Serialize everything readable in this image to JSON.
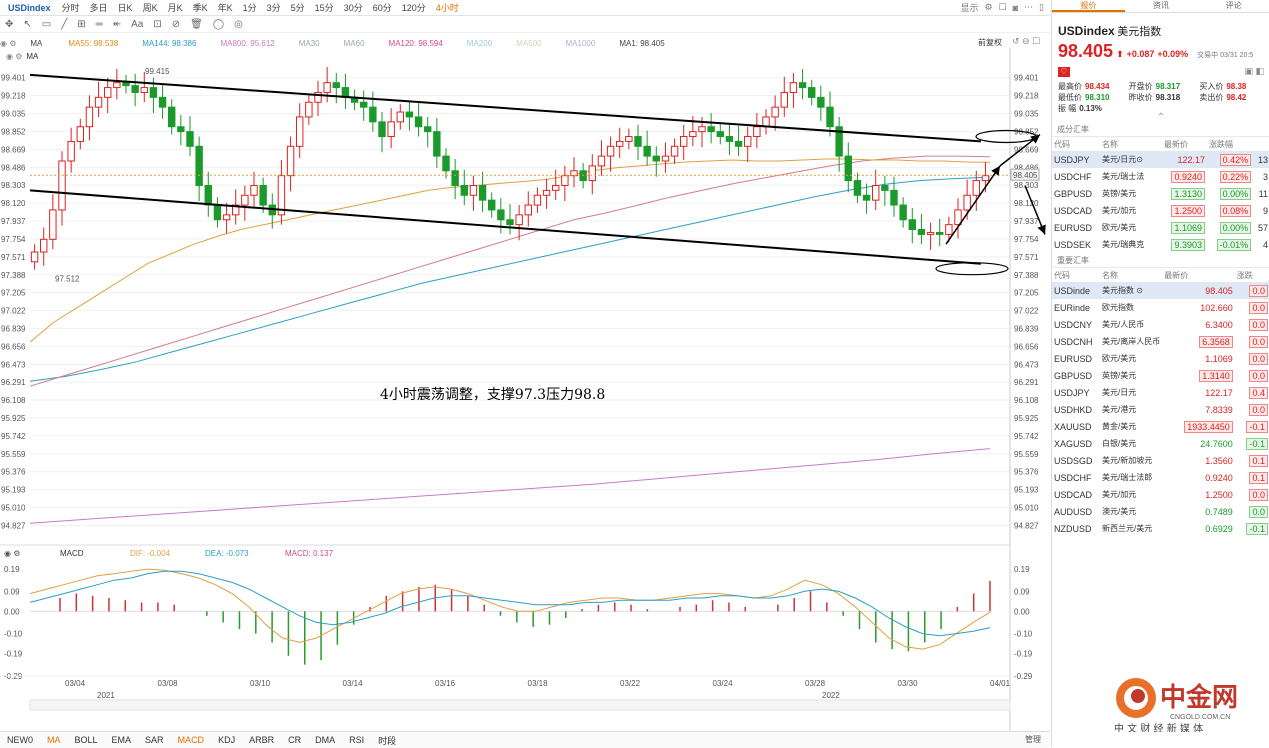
{
  "toolbar": {
    "symbol": "USDindex",
    "timeframes": [
      "分时",
      "多日",
      "日K",
      "周K",
      "月K",
      "季K",
      "年K",
      "1分",
      "3分",
      "5分",
      "15分",
      "30分",
      "60分",
      "120分",
      "4小时"
    ],
    "active_timeframe": "4小时",
    "right": {
      "display": "显示"
    }
  },
  "ma_legend_main": [
    {
      "label": "MA",
      "color": "#444"
    },
    {
      "label": "MA55: 98.538",
      "color": "#e08a1a"
    },
    {
      "label": "MA144: 98.386",
      "color": "#2aa0c8"
    },
    {
      "label": "MA800: 95.612",
      "color": "#c87ac8"
    },
    {
      "label": "MA30",
      "color": "#9aa"
    },
    {
      "label": "MA60",
      "color": "#9aa"
    },
    {
      "label": "MA120: 98.594",
      "color": "#d24a8a"
    },
    {
      "label": "MA200",
      "color": "#9cc"
    },
    {
      "label": "MA500",
      "color": "#dcb"
    },
    {
      "label": "MA1000",
      "color": "#bac"
    },
    {
      "label": "MA1: 98.405",
      "color": "#444"
    }
  ],
  "ma_legend_right": "前复权",
  "ma_legend_sub": "MA",
  "macd_legend": {
    "name": "MACD",
    "dif": "DIF: -0.004",
    "dea": "DEA: -0.073",
    "macd": "MACD: 0.137"
  },
  "annotation": "4小时震荡调整，支撑97.3压力98.8",
  "high_label": "99.415",
  "low_label": "97.512",
  "current_price_tag": "98.405",
  "indicator_tabs": [
    "NEW0",
    "MA",
    "BOLL",
    "EMA",
    "SAR",
    "MACD",
    "KDJ",
    "ARBR",
    "CR",
    "DMA",
    "RSI",
    "时段"
  ],
  "indicator_active": [
    "MA",
    "MACD"
  ],
  "manage_label": "管理",
  "years": {
    "left": "2021",
    "right": "2022"
  },
  "chart_data": {
    "type": "candlestick",
    "y_ticks": [
      "99.401",
      "99.218",
      "99.035",
      "98.852",
      "98.669",
      "98.486",
      "98.303",
      "98.120",
      "97.937",
      "97.754",
      "97.571",
      "97.388",
      "97.205",
      "97.022",
      "96.839",
      "96.656",
      "96.473",
      "96.291",
      "96.108",
      "95.925",
      "95.742",
      "95.559",
      "95.376",
      "95.193",
      "95.010",
      "94.827"
    ],
    "ylim": [
      94.75,
      99.5
    ],
    "x_ticks": [
      "03/04",
      "03/08",
      "03/10",
      "03/14",
      "03/16",
      "03/18",
      "03/22",
      "03/24",
      "03/28",
      "03/30",
      "04/01"
    ],
    "closes": [
      97.62,
      97.75,
      98.05,
      98.55,
      98.75,
      98.9,
      99.1,
      99.2,
      99.3,
      99.35,
      99.32,
      99.25,
      99.3,
      99.2,
      99.1,
      98.9,
      98.85,
      98.7,
      98.3,
      98.1,
      97.95,
      98.0,
      98.1,
      98.2,
      98.3,
      98.1,
      98.0,
      98.4,
      98.7,
      99.0,
      99.15,
      99.25,
      99.35,
      99.3,
      99.2,
      99.15,
      99.1,
      98.95,
      98.8,
      98.95,
      99.05,
      99.0,
      98.9,
      98.85,
      98.6,
      98.45,
      98.3,
      98.2,
      98.3,
      98.15,
      98.05,
      97.95,
      97.9,
      98.0,
      98.1,
      98.2,
      98.25,
      98.3,
      98.4,
      98.45,
      98.35,
      98.5,
      98.6,
      98.7,
      98.75,
      98.8,
      98.7,
      98.6,
      98.55,
      98.6,
      98.7,
      98.8,
      98.85,
      98.9,
      98.85,
      98.8,
      98.75,
      98.7,
      98.8,
      98.9,
      99.0,
      99.1,
      99.25,
      99.35,
      99.3,
      99.2,
      99.1,
      98.9,
      98.6,
      98.35,
      98.2,
      98.15,
      98.3,
      98.25,
      98.1,
      97.95,
      97.85,
      97.8,
      97.82,
      97.8,
      97.9,
      98.05,
      98.2,
      98.35,
      98.4
    ],
    "ma55": [
      96.7,
      96.9,
      97.05,
      97.2,
      97.35,
      97.5,
      97.6,
      97.7,
      97.78,
      97.85,
      97.9,
      97.95,
      98.0,
      98.05,
      98.1,
      98.15,
      98.2,
      98.25,
      98.28,
      98.3,
      98.32,
      98.34,
      98.36,
      98.4,
      98.45,
      98.48,
      98.5,
      98.52,
      98.54,
      98.55,
      98.56,
      98.55,
      98.55,
      98.56,
      98.57,
      98.57,
      98.56,
      98.56,
      98.55,
      98.55,
      98.54,
      98.538
    ],
    "ma120": [
      96.25,
      96.35,
      96.45,
      96.55,
      96.65,
      96.75,
      96.85,
      96.95,
      97.05,
      97.15,
      97.25,
      97.35,
      97.45,
      97.55,
      97.65,
      97.75,
      97.85,
      97.95,
      98.02,
      98.1,
      98.18,
      98.25,
      98.32,
      98.38,
      98.44,
      98.5,
      98.55,
      98.58,
      98.6,
      98.6,
      98.594
    ],
    "ma144": [
      96.3,
      96.35,
      96.42,
      96.5,
      96.6,
      96.7,
      96.8,
      96.9,
      97.0,
      97.1,
      97.2,
      97.3,
      97.38,
      97.46,
      97.54,
      97.62,
      97.7,
      97.78,
      97.86,
      97.94,
      98.02,
      98.1,
      98.18,
      98.25,
      98.31,
      98.35,
      98.37,
      98.386
    ],
    "ma800": [
      94.85,
      94.89,
      94.93,
      94.97,
      95.01,
      95.05,
      95.09,
      95.13,
      95.17,
      95.21,
      95.25,
      95.3,
      95.35,
      95.4,
      95.45,
      95.5,
      95.56,
      95.612
    ],
    "trendlines": [
      {
        "from": [
          0,
          99.43
        ],
        "to": [
          104,
          98.75
        ]
      },
      {
        "from": [
          0,
          98.25
        ],
        "to": [
          104,
          97.5
        ]
      }
    ],
    "macd": {
      "ylim": [
        -0.3,
        0.24
      ],
      "y_ticks": [
        "0.19",
        "0.09",
        "0.00",
        "-0.10",
        "-0.19",
        "-0.29"
      ],
      "dif": [
        0.08,
        0.1,
        0.12,
        0.14,
        0.16,
        0.17,
        0.18,
        0.19,
        0.185,
        0.17,
        0.15,
        0.12,
        0.08,
        0.02,
        -0.06,
        -0.12,
        -0.14,
        -0.12,
        -0.08,
        -0.04,
        0.0,
        0.04,
        0.08,
        0.1,
        0.11,
        0.1,
        0.08,
        0.05,
        0.02,
        0.0,
        0.0,
        0.02,
        0.04,
        0.05,
        0.06,
        0.06,
        0.05,
        0.05,
        0.06,
        0.07,
        0.08,
        0.08,
        0.07,
        0.06,
        0.07,
        0.1,
        0.14,
        0.12,
        0.08,
        0.02,
        -0.05,
        -0.12,
        -0.16,
        -0.17,
        -0.15,
        -0.1,
        -0.05,
        -0.004
      ],
      "dea": [
        0.04,
        0.06,
        0.08,
        0.1,
        0.12,
        0.14,
        0.15,
        0.17,
        0.18,
        0.18,
        0.17,
        0.15,
        0.13,
        0.1,
        0.06,
        0.02,
        -0.02,
        -0.05,
        -0.06,
        -0.05,
        -0.03,
        -0.01,
        0.02,
        0.04,
        0.06,
        0.07,
        0.07,
        0.06,
        0.05,
        0.04,
        0.03,
        0.03,
        0.03,
        0.04,
        0.04,
        0.05,
        0.05,
        0.05,
        0.05,
        0.06,
        0.06,
        0.07,
        0.07,
        0.06,
        0.06,
        0.07,
        0.09,
        0.1,
        0.09,
        0.06,
        0.02,
        -0.03,
        -0.07,
        -0.1,
        -0.11,
        -0.1,
        -0.09,
        -0.073
      ],
      "hist": [
        0.06,
        0.08,
        0.07,
        0.06,
        0.05,
        0.04,
        0.04,
        0.03,
        0.0,
        -0.02,
        -0.05,
        -0.08,
        -0.1,
        -0.14,
        -0.2,
        -0.24,
        -0.22,
        -0.15,
        -0.06,
        0.02,
        0.07,
        0.09,
        0.11,
        0.12,
        0.1,
        0.07,
        0.03,
        -0.02,
        -0.05,
        -0.07,
        -0.06,
        -0.03,
        0.01,
        0.03,
        0.04,
        0.03,
        0.01,
        0.0,
        0.02,
        0.03,
        0.05,
        0.04,
        0.02,
        0.0,
        0.03,
        0.06,
        0.09,
        0.04,
        -0.02,
        -0.08,
        -0.14,
        -0.17,
        -0.18,
        -0.14,
        -0.08,
        0.02,
        0.08,
        0.137
      ]
    }
  },
  "quote": {
    "symbol": "USDindex",
    "name": "美元指数",
    "price": "98.405",
    "arrow": "⬆",
    "change": "+0.087",
    "change_pct": "+0.09%",
    "status": "交易中 03/31 20:5",
    "rows": [
      [
        {
          "k": "最高价",
          "v": "98.434",
          "c": "red"
        },
        {
          "k": "开盘价",
          "v": "98.317",
          "c": "green"
        },
        {
          "k": "买入价",
          "v": "98.38",
          "c": "red"
        }
      ],
      [
        {
          "k": "最低价",
          "v": "98.310",
          "c": "green"
        },
        {
          "k": "昨收价",
          "v": "98.318",
          "c": ""
        },
        {
          "k": "卖出价",
          "v": "98.42",
          "c": "red"
        }
      ],
      [
        {
          "k": "振 幅",
          "v": "0.13%",
          "c": ""
        }
      ]
    ]
  },
  "tabs": [
    "报价",
    "资讯",
    "评论"
  ],
  "section1": {
    "title": "成分汇率",
    "headers": [
      "代码",
      "名称",
      "最新价",
      "涨跌幅"
    ],
    "rows": [
      {
        "code": "USDJPY",
        "name": "美元/日元⊙",
        "price": "122.17",
        "pct": "0.42%",
        "extra": "13",
        "dir": "red",
        "sel": true
      },
      {
        "code": "USDCHF",
        "name": "美元/瑞士法",
        "price": "0.9240",
        "pct": "0.22%",
        "extra": "3",
        "dir": "red",
        "sel": false
      },
      {
        "code": "GBPUSD",
        "name": "英镑/美元",
        "price": "1.3130",
        "pct": "0.00%",
        "extra": "11",
        "dir": "green",
        "sel": false
      },
      {
        "code": "USDCAD",
        "name": "美元/加元",
        "price": "1.2500",
        "pct": "0.08%",
        "extra": "9",
        "dir": "red",
        "sel": false
      },
      {
        "code": "EURUSD",
        "name": "欧元/美元",
        "price": "1.1069",
        "pct": "0.00%",
        "extra": "57",
        "dir": "green",
        "sel": false
      },
      {
        "code": "USDSEK",
        "name": "美元/瑞典克",
        "price": "9.3903",
        "pct": "-0.01%",
        "extra": "4",
        "dir": "green",
        "sel": false
      }
    ]
  },
  "section2": {
    "title": "重要汇率",
    "headers": [
      "代码",
      "名称",
      "最新价",
      "涨跌"
    ],
    "rows": [
      {
        "code": "USDinde",
        "name": "美元指数 ⊙",
        "price": "98.405",
        "pct": "0.0",
        "dir": "red",
        "sel": true
      },
      {
        "code": "EURinde",
        "name": "欧元指数",
        "price": "102.660",
        "pct": "0.0",
        "dir": "red",
        "sel": false
      },
      {
        "code": "USDCNY",
        "name": "美元/人民币",
        "price": "6.3400",
        "pct": "0.0",
        "dir": "red",
        "sel": false
      },
      {
        "code": "USDCNH",
        "name": "美元/离岸人民币",
        "price": "6.3568",
        "pct": "0.0",
        "dir": "red",
        "sel": false
      },
      {
        "code": "EURUSD",
        "name": "欧元/美元",
        "price": "1.1069",
        "pct": "0.0",
        "dir": "red",
        "sel": false
      },
      {
        "code": "GBPUSD",
        "name": "英镑/美元",
        "price": "1.3140",
        "pct": "0.0",
        "dir": "red",
        "sel": false
      },
      {
        "code": "USDJPY",
        "name": "美元/日元",
        "price": "122.17",
        "pct": "0.4",
        "dir": "red",
        "sel": false
      },
      {
        "code": "USDHKD",
        "name": "美元/港元",
        "price": "7.8339",
        "pct": "0.0",
        "dir": "red",
        "sel": false
      },
      {
        "code": "XAUUSD",
        "name": "黄金/美元",
        "price": "1933.4450",
        "pct": "-0.1",
        "dir": "red",
        "sel": false
      },
      {
        "code": "XAGUSD",
        "name": "白银/美元",
        "price": "24.7600",
        "pct": "-0.1",
        "dir": "green",
        "sel": false
      },
      {
        "code": "USDSGD",
        "name": "美元/新加坡元",
        "price": "1.3560",
        "pct": "0.1",
        "dir": "red",
        "sel": false
      },
      {
        "code": "USDCHF",
        "name": "美元/瑞士法郎",
        "price": "0.9240",
        "pct": "0.1",
        "dir": "red",
        "sel": false
      },
      {
        "code": "USDCAD",
        "name": "美元/加元",
        "price": "1.2500",
        "pct": "0.0",
        "dir": "red",
        "sel": false
      },
      {
        "code": "AUDUSD",
        "name": "澳元/美元",
        "price": "0.7489",
        "pct": "0.0",
        "dir": "green",
        "sel": false
      },
      {
        "code": "NZDUSD",
        "name": "新西兰元/美元",
        "price": "0.6929",
        "pct": "-0.1",
        "dir": "green",
        "sel": false
      }
    ]
  },
  "watermark": {
    "brand": "中金网",
    "domain": "CNGOLD.COM.CN",
    "tagline": "中 文 财 经 新 媒 体"
  }
}
